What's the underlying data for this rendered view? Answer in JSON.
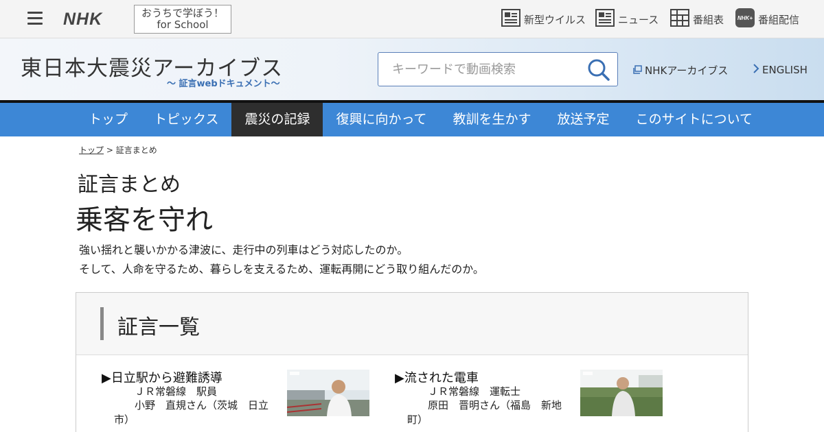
{
  "topbar": {
    "logo": "NHK",
    "school_line1": "おうちで学ぼう！",
    "school_line2": "for School",
    "links": [
      {
        "label": "新型ウイルス",
        "icon": "news-grid-icon"
      },
      {
        "label": "ニュース",
        "icon": "newspaper-icon"
      },
      {
        "label": "番組表",
        "icon": "program-table-icon"
      },
      {
        "label": "番組配信",
        "icon": "nhk-plus-icon"
      }
    ]
  },
  "header": {
    "site_title": "東日本大震災アーカイブス",
    "site_subtitle": "〜 証言webドキュメント〜",
    "search_placeholder": "キーワードで動画検索",
    "archive_link": "NHKアーカイブス",
    "english_link": "ENGLISH"
  },
  "nav": {
    "items": [
      "トップ",
      "トピックス",
      "震災の記録",
      "復興に向かって",
      "教訓を生かす",
      "放送予定",
      "このサイトについて"
    ],
    "active_index": 2
  },
  "breadcrumb": {
    "home": "トップ",
    "separator": ">",
    "current": "証言まとめ"
  },
  "page": {
    "section_label": "証言まとめ",
    "title": "乗客を守れ",
    "lead_line1": "強い揺れと襲いかかる津波に、走行中の列車はどう対応したのか。",
    "lead_line2": "そして、人命を守るため、暮らしを支えるため、運転再開にどう取り組んだのか。"
  },
  "testimonies": {
    "heading": "証言一覧",
    "items": [
      {
        "title": "▶日立駅から避難誘導",
        "role": "ＪＲ常磐線　駅員",
        "name": "小野　直規さん（茨城　日立市）",
        "thumb_icon": "video-thumbnail-icon"
      },
      {
        "title": "▶流された電車",
        "role": "ＪＲ常磐線　運転士",
        "name": "原田　晋明さん（福島　新地町）",
        "thumb_icon": "video-thumbnail-icon"
      }
    ]
  },
  "colors": {
    "nav_bg": "#3d87d6",
    "nav_active": "#2e2e2e",
    "accent": "#3a6fb3"
  }
}
